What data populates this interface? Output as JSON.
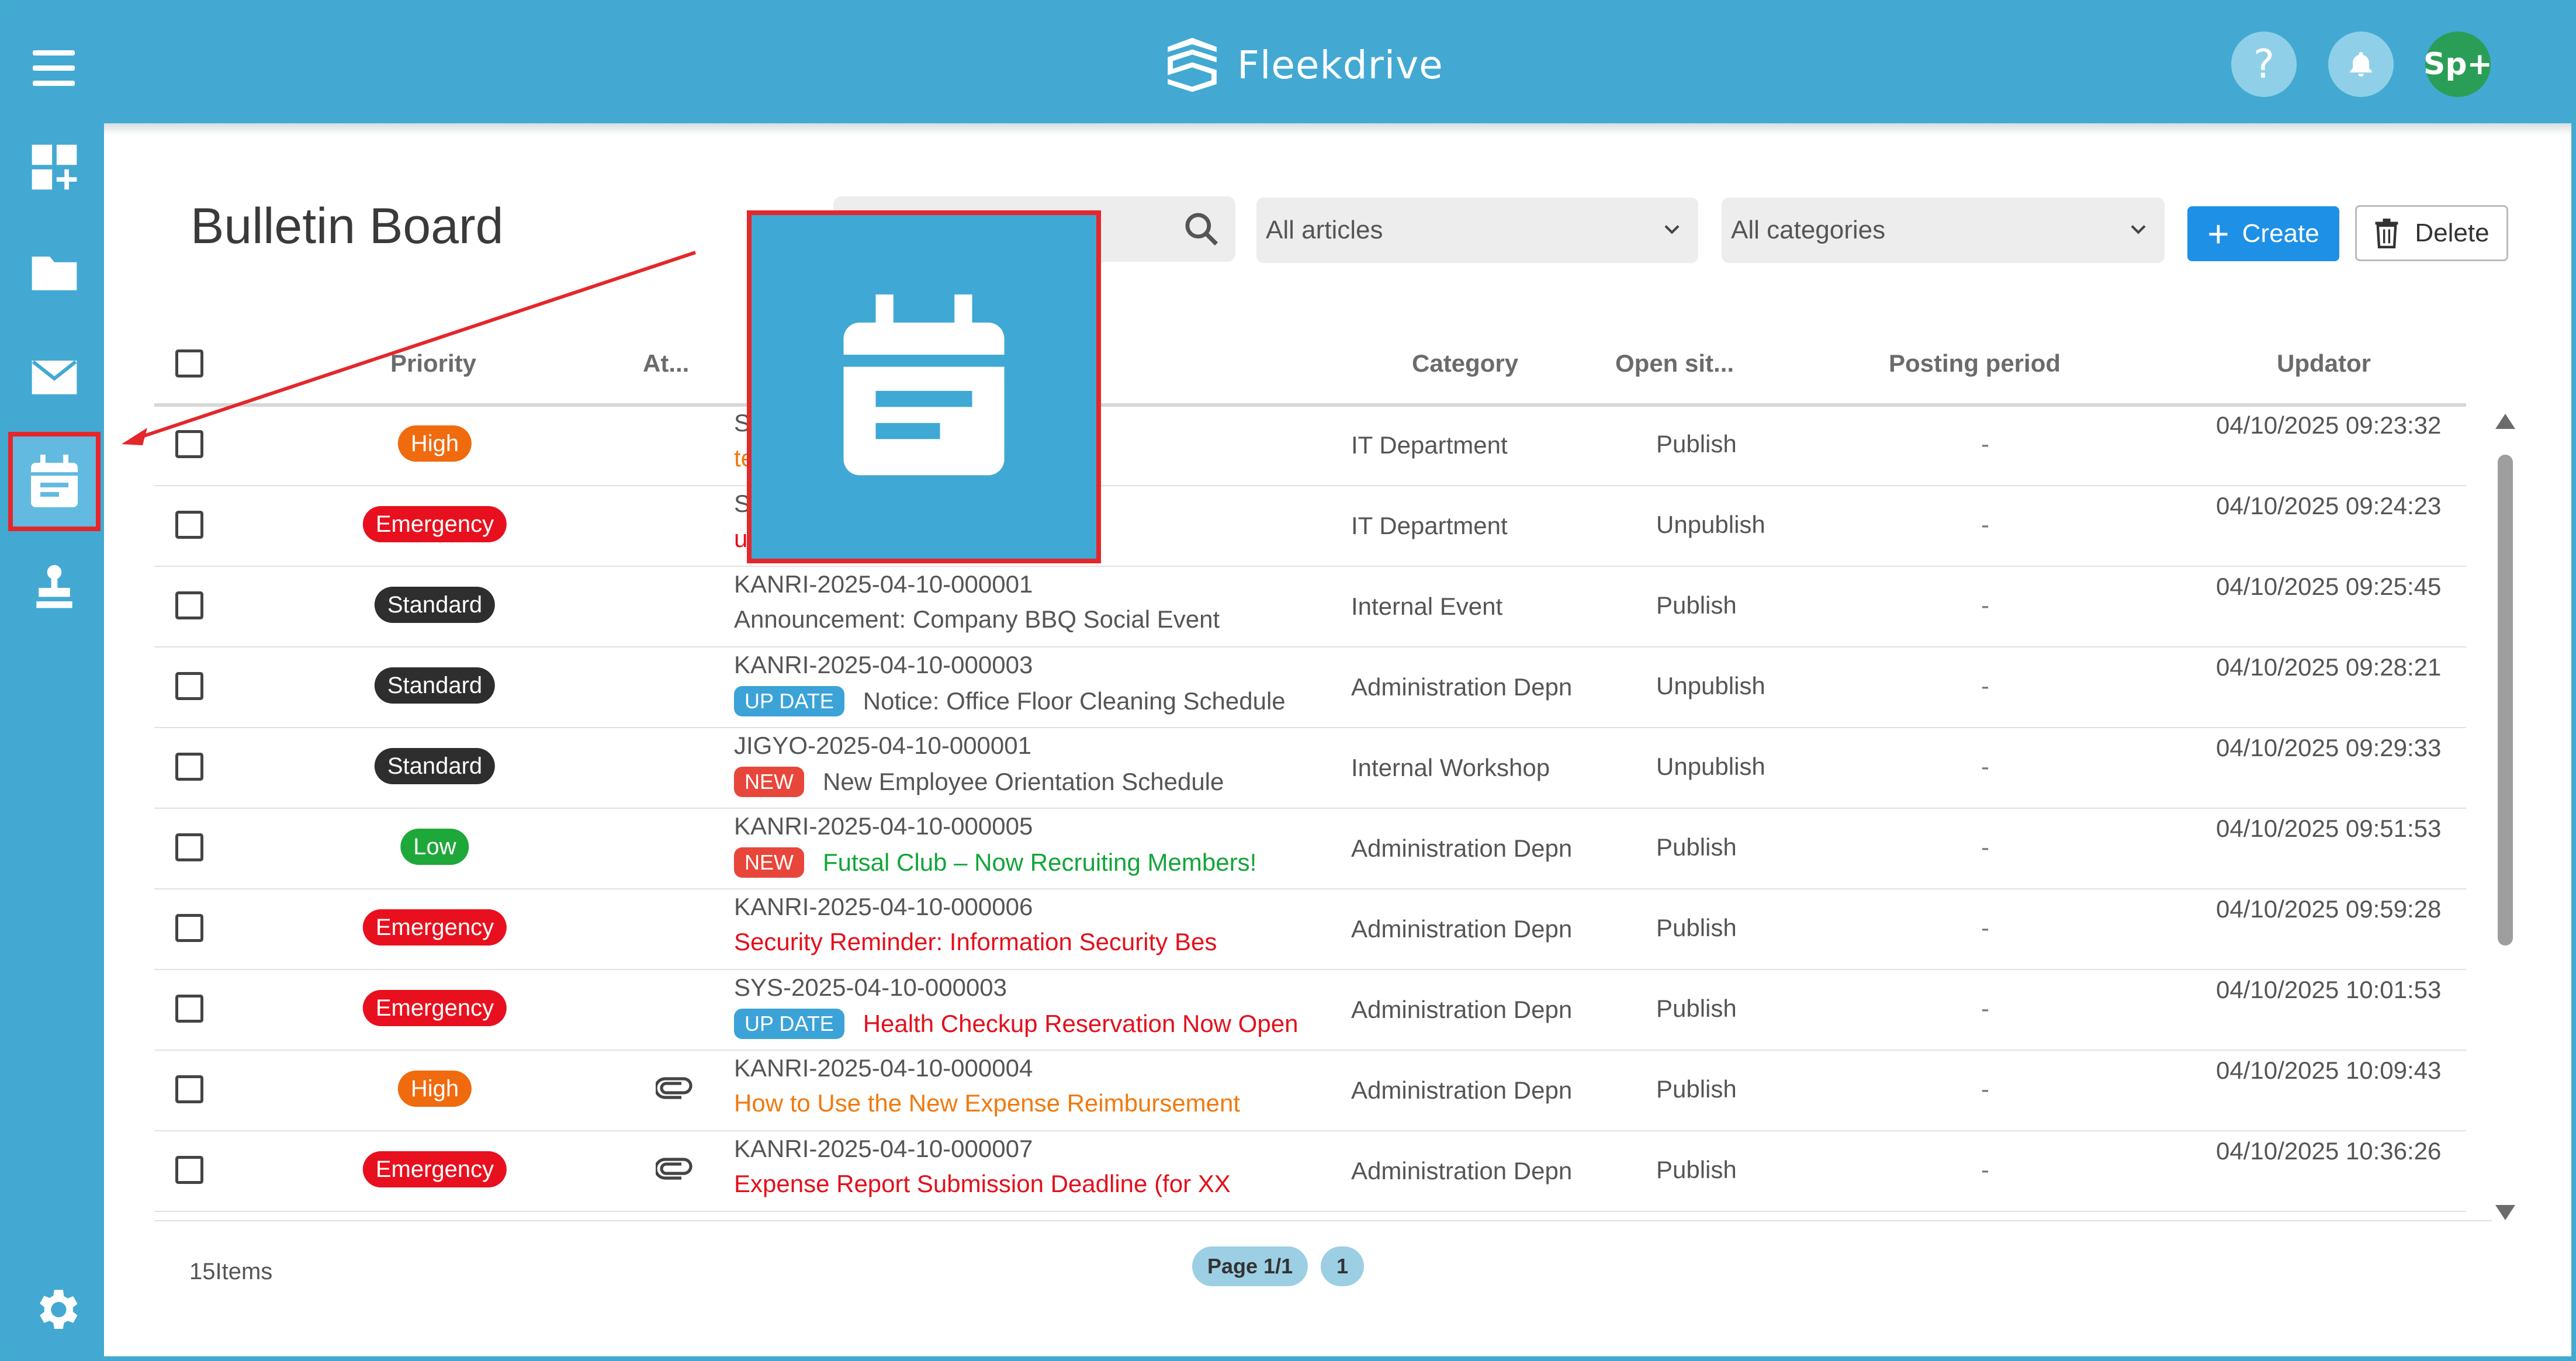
{
  "app": {
    "name": "Fleekdrive",
    "avatar_text": "Sp+",
    "help_text": "?"
  },
  "page": {
    "title": "Bulletin Board"
  },
  "toolbar": {
    "search_placeholder": "",
    "articles_filter": "All articles",
    "categories_filter": "All categories",
    "create_label": "Create",
    "delete_label": "Delete"
  },
  "table": {
    "headers": {
      "priority": "Priority",
      "attachment": "At...",
      "category": "Category",
      "open_status": "Open sit...",
      "posting_period": "Posting period",
      "updator": "Updator"
    },
    "rows": [
      {
        "priority": "High",
        "id": "S",
        "tag": "",
        "title": "tenance",
        "title_color": "orange",
        "attachment": false,
        "category": "IT Department",
        "status": "Publish",
        "posting": "-",
        "updated": "04/10/2025 09:23:32"
      },
      {
        "priority": "Emergency",
        "id": "S",
        "tag": "",
        "title": "utage",
        "title_color": "red",
        "attachment": false,
        "category": "IT Department",
        "status": "Unpublish",
        "posting": "-",
        "updated": "04/10/2025 09:24:23"
      },
      {
        "priority": "Standard",
        "id": "KANRI-2025-04-10-000001",
        "tag": "",
        "title": "Announcement: Company BBQ Social Event",
        "title_color": "gray",
        "attachment": false,
        "category": "Internal Event",
        "status": "Publish",
        "posting": "-",
        "updated": "04/10/2025 09:25:45"
      },
      {
        "priority": "Standard",
        "id": "KANRI-2025-04-10-000003",
        "tag": "UP DATE",
        "title": "Notice: Office Floor Cleaning Schedule",
        "title_color": "gray",
        "attachment": false,
        "category": "Administration Depn",
        "status": "Unpublish",
        "posting": "-",
        "updated": "04/10/2025 09:28:21"
      },
      {
        "priority": "Standard",
        "id": "JIGYO-2025-04-10-000001",
        "tag": "NEW",
        "title": "New Employee Orientation Schedule",
        "title_color": "gray",
        "attachment": false,
        "category": "Internal Workshop",
        "status": "Unpublish",
        "posting": "-",
        "updated": "04/10/2025 09:29:33"
      },
      {
        "priority": "Low",
        "id": "KANRI-2025-04-10-000005",
        "tag": "NEW",
        "title": "Futsal Club – Now Recruiting Members!",
        "title_color": "green",
        "attachment": false,
        "category": "Administration Depn",
        "status": "Publish",
        "posting": "-",
        "updated": "04/10/2025 09:51:53"
      },
      {
        "priority": "Emergency",
        "id": "KANRI-2025-04-10-000006",
        "tag": "",
        "title": "Security Reminder: Information Security Bes",
        "title_color": "red",
        "attachment": false,
        "category": "Administration Depn",
        "status": "Publish",
        "posting": "-",
        "updated": "04/10/2025 09:59:28"
      },
      {
        "priority": "Emergency",
        "id": "SYS-2025-04-10-000003",
        "tag": "UP DATE",
        "title": "Health Checkup Reservation Now Open",
        "title_color": "red",
        "attachment": false,
        "category": "Administration Depn",
        "status": "Publish",
        "posting": "-",
        "updated": "04/10/2025 10:01:53"
      },
      {
        "priority": "High",
        "id": "KANRI-2025-04-10-000004",
        "tag": "",
        "title": "How to Use the New Expense Reimbursement",
        "title_color": "orange",
        "attachment": true,
        "category": "Administration Depn",
        "status": "Publish",
        "posting": "-",
        "updated": "04/10/2025 10:09:43"
      },
      {
        "priority": "Emergency",
        "id": "KANRI-2025-04-10-000007",
        "tag": "",
        "title": "Expense Report Submission Deadline (for XX",
        "title_color": "red",
        "attachment": true,
        "category": "Administration Depn",
        "status": "Publish",
        "posting": "-",
        "updated": "04/10/2025 10:36:26"
      }
    ]
  },
  "footer": {
    "items_count": "15Items",
    "page_label": "Page 1/1",
    "page_number": "1"
  },
  "colors": {
    "brand": "#43A9D2",
    "highlight": "#E4272B",
    "create": "#1E90E6"
  },
  "icons": {
    "sidebar": [
      "dashboard-add-icon",
      "folder-icon",
      "mail-icon",
      "calendar-icon",
      "stamp-icon"
    ],
    "settings": "gear-icon"
  }
}
